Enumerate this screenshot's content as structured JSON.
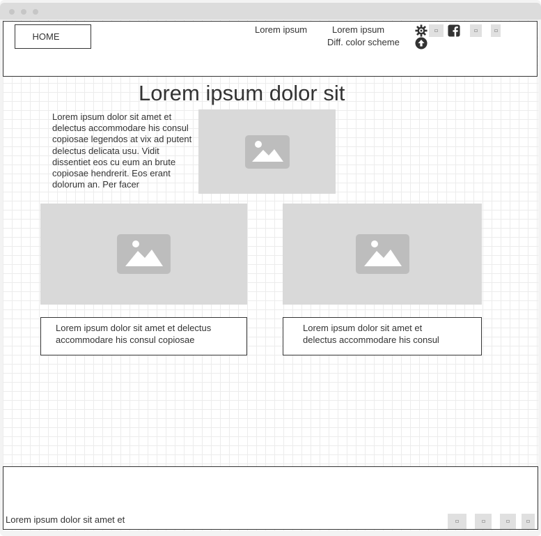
{
  "header": {
    "home_label": "HOME",
    "nav_link_1": "Lorem ipsum",
    "nav_link_2": "Lorem ipsum",
    "color_scheme_label": "Diff. color scheme",
    "icons": [
      "gear-icon",
      "arrow-up-icon",
      "facebook-icon"
    ]
  },
  "main": {
    "title": "Lorem ipsum dolor sit",
    "intro_text": "Lorem ipsum dolor sit amet et delectus accommodare his consul copiosae legendos at vix ad putent delectus delicata usu. Vidit dissentiet eos cu eum an brute copiosae hendrerit. Eos erant dolorum an. Per facer",
    "caption_left": "Lorem ipsum dolor sit amet et delectus accommodare his consul copiosae",
    "caption_right": "Lorem ipsum dolor sit amet et delectus accommodare his consul"
  },
  "footer": {
    "text": "Lorem ipsum dolor sit amet et"
  },
  "colors": {
    "placeholder": "#d9d9d9",
    "border": "#333333",
    "grid": "#ececec"
  }
}
